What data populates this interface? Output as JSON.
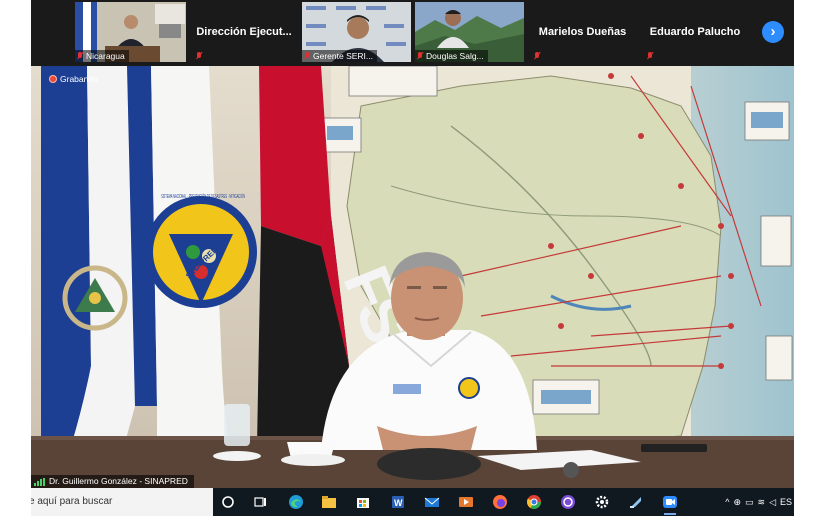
{
  "participants": [
    {
      "name": "Nicaragua",
      "display": "caption"
    },
    {
      "name": "Dirección Ejecut...",
      "display": "name"
    },
    {
      "name": "Gerente SERI...",
      "display": "caption"
    },
    {
      "name": "Douglas Salg...",
      "display": "caption"
    },
    {
      "name": "Marielos Dueñas",
      "display": "name"
    },
    {
      "name": "Eduardo Palucho",
      "display": "name"
    }
  ],
  "next_page_icon": "chevron-right-icon",
  "recording": {
    "label": "Grabando",
    "color": "#e84b3a"
  },
  "active_speaker": {
    "name": "Dr. Guillermo González - SINAPRED"
  },
  "scene_text": {
    "emblem_ring": "SISTEMA NACIONAL · PREVENCIÓN DE DESASTRES · MITIGACIÓN",
    "emblem_label": "SINAPRED",
    "flag_letters": "FSLN"
  },
  "taskbar": {
    "search_placeholder": "e aquí para buscar",
    "apps": [
      {
        "name": "start-circle-icon"
      },
      {
        "name": "task-view-icon"
      },
      {
        "name": "edge-browser-icon"
      },
      {
        "name": "file-explorer-icon"
      },
      {
        "name": "microsoft-store-icon"
      },
      {
        "name": "word-icon"
      },
      {
        "name": "mail-icon"
      },
      {
        "name": "media-player-icon"
      },
      {
        "name": "firefox-icon"
      },
      {
        "name": "chrome-icon"
      },
      {
        "name": "circle-app-icon"
      },
      {
        "name": "settings-icon"
      },
      {
        "name": "notes-icon"
      },
      {
        "name": "zoom-icon",
        "active": true
      }
    ],
    "tray_language": "ES"
  },
  "colors": {
    "zoom_blue": "#2d8cff",
    "taskbar_bg": "#101820",
    "strip_bg": "#1a1a1a",
    "flag_blue": "#1c3f94",
    "fsln_red": "#c8102e"
  }
}
